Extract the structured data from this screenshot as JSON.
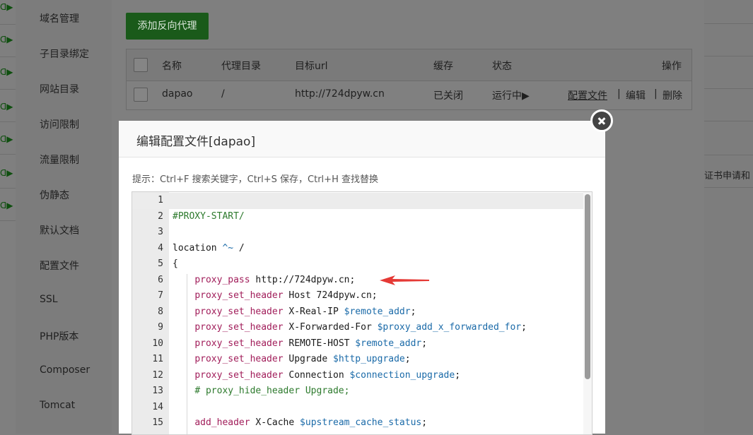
{
  "left_strip": {
    "rows": [
      {
        "label": "ᗡ▶"
      },
      {
        "label": "ᗡ▶"
      },
      {
        "label": "ᗡ▶"
      },
      {
        "label": "ᗡ▶"
      },
      {
        "label": "ᗡ▶"
      },
      {
        "label": "ᗡ▶"
      },
      {
        "label": "ᗡ▶"
      }
    ]
  },
  "side_menu": {
    "items": [
      {
        "label": "域名管理"
      },
      {
        "label": "子目录绑定"
      },
      {
        "label": "网站目录"
      },
      {
        "label": "访问限制"
      },
      {
        "label": "流量限制"
      },
      {
        "label": "伪静态"
      },
      {
        "label": "默认文档"
      },
      {
        "label": "配置文件"
      },
      {
        "label": "SSL"
      },
      {
        "label": "PHP版本"
      },
      {
        "label": "Composer"
      },
      {
        "label": "Tomcat"
      }
    ]
  },
  "right_text": "证书申请和",
  "toolbar": {
    "add_proxy_label": "添加反向代理"
  },
  "table": {
    "headers": {
      "name": "名称",
      "proxy_dir": "代理目录",
      "target_url": "目标url",
      "cache": "缓存",
      "status": "状态",
      "actions": "操作"
    },
    "rows": [
      {
        "name": "dapao",
        "proxy_dir": "/",
        "target_url": "http://724dpyw.cn",
        "cache": "已关闭",
        "status": "运行中▶",
        "config_link": "配置文件",
        "edit_link": "编辑",
        "delete_link": "删除",
        "separator": "|"
      }
    ]
  },
  "modal": {
    "title": "编辑配置文件[dapao]",
    "hint": "提示：Ctrl+F 搜索关键字，Ctrl+S 保存，Ctrl+H 查找替换",
    "lines": [
      {
        "n": "1",
        "segs": []
      },
      {
        "n": "2",
        "segs": [
          {
            "c": "cm",
            "t": "#PROXY-START/"
          }
        ]
      },
      {
        "n": "3",
        "segs": []
      },
      {
        "n": "4",
        "segs": [
          {
            "c": "",
            "t": "location "
          },
          {
            "c": "op",
            "t": "^~"
          },
          {
            "c": "",
            "t": " /"
          }
        ]
      },
      {
        "n": "5",
        "segs": [
          {
            "c": "",
            "t": "{"
          }
        ]
      },
      {
        "n": "6",
        "segs": [
          {
            "c": "",
            "t": "    "
          },
          {
            "c": "kw",
            "t": "proxy_pass"
          },
          {
            "c": "",
            "t": " http://724dpyw.cn;"
          }
        ]
      },
      {
        "n": "7",
        "segs": [
          {
            "c": "",
            "t": "    "
          },
          {
            "c": "kw",
            "t": "proxy_set_header"
          },
          {
            "c": "",
            "t": " Host 724dpyw.cn;"
          }
        ]
      },
      {
        "n": "8",
        "segs": [
          {
            "c": "",
            "t": "    "
          },
          {
            "c": "kw",
            "t": "proxy_set_header"
          },
          {
            "c": "",
            "t": " X-Real-IP "
          },
          {
            "c": "var",
            "t": "$remote_addr"
          },
          {
            "c": "",
            "t": ";"
          }
        ]
      },
      {
        "n": "9",
        "segs": [
          {
            "c": "",
            "t": "    "
          },
          {
            "c": "kw",
            "t": "proxy_set_header"
          },
          {
            "c": "",
            "t": " X-Forwarded-For "
          },
          {
            "c": "var",
            "t": "$proxy_add_x_forwarded_for"
          },
          {
            "c": "",
            "t": ";"
          }
        ]
      },
      {
        "n": "10",
        "segs": [
          {
            "c": "",
            "t": "    "
          },
          {
            "c": "kw",
            "t": "proxy_set_header"
          },
          {
            "c": "",
            "t": " REMOTE-HOST "
          },
          {
            "c": "var",
            "t": "$remote_addr"
          },
          {
            "c": "",
            "t": ";"
          }
        ]
      },
      {
        "n": "11",
        "segs": [
          {
            "c": "",
            "t": "    "
          },
          {
            "c": "kw",
            "t": "proxy_set_header"
          },
          {
            "c": "",
            "t": " Upgrade "
          },
          {
            "c": "var",
            "t": "$http_upgrade"
          },
          {
            "c": "",
            "t": ";"
          }
        ]
      },
      {
        "n": "12",
        "segs": [
          {
            "c": "",
            "t": "    "
          },
          {
            "c": "kw",
            "t": "proxy_set_header"
          },
          {
            "c": "",
            "t": " Connection "
          },
          {
            "c": "var",
            "t": "$connection_upgrade"
          },
          {
            "c": "",
            "t": ";"
          }
        ]
      },
      {
        "n": "13",
        "segs": [
          {
            "c": "",
            "t": "    "
          },
          {
            "c": "cm",
            "t": "# proxy_hide_header Upgrade;"
          }
        ]
      },
      {
        "n": "14",
        "segs": []
      },
      {
        "n": "15",
        "segs": [
          {
            "c": "",
            "t": "    "
          },
          {
            "c": "kw",
            "t": "add_header"
          },
          {
            "c": "",
            "t": " X-Cache "
          },
          {
            "c": "var",
            "t": "$upstream_cache_status"
          },
          {
            "c": "",
            "t": ";"
          }
        ]
      }
    ]
  },
  "colors": {
    "accent_green": "#20a53a",
    "keyword": "#a11d5a",
    "variable": "#1a6aa8",
    "comment": "#2d7a2d",
    "annotation_arrow": "#e53935"
  },
  "icons": [
    "close-icon",
    "red-arrow-annotation",
    "checkbox"
  ]
}
